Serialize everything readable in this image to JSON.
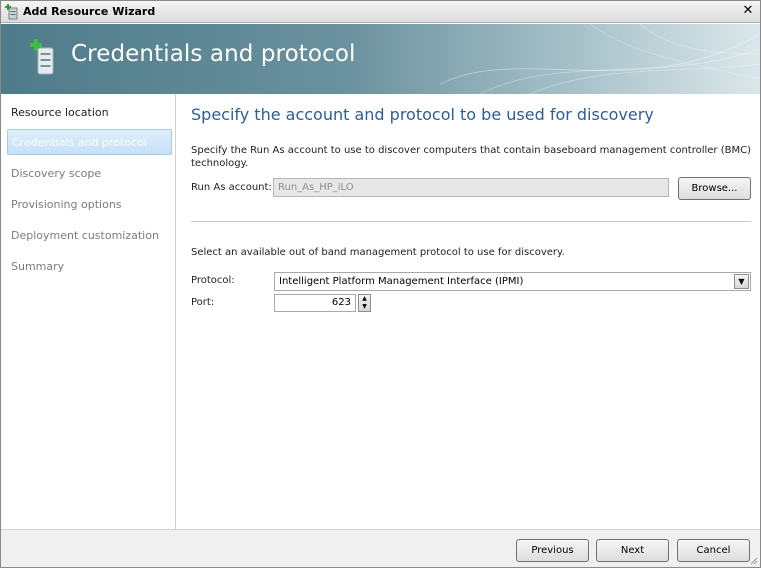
{
  "window": {
    "title": "Add Resource Wizard",
    "close_glyph": "✕"
  },
  "banner": {
    "title": "Credentials and protocol"
  },
  "nav": {
    "items": [
      {
        "label": "Resource location",
        "state": "visited"
      },
      {
        "label": "Credentials and protocol",
        "state": "selected"
      },
      {
        "label": "Discovery scope",
        "state": "upcoming"
      },
      {
        "label": "Provisioning options",
        "state": "upcoming"
      },
      {
        "label": "Deployment customization",
        "state": "upcoming"
      },
      {
        "label": "Summary",
        "state": "upcoming"
      }
    ]
  },
  "main": {
    "heading": "Specify the account and protocol to be used for discovery",
    "description": "Specify the Run As account to use to discover computers that contain baseboard management controller (BMC) technology.",
    "run_as_label": "Run As account:",
    "run_as_value": "Run_As_HP_iLO",
    "browse_label": "Browse...",
    "protocol_intro": "Select an available out of band management protocol to use for discovery.",
    "protocol_label": "Protocol:",
    "protocol_value": "Intelligent Platform Management Interface (IPMI)",
    "port_label": "Port:",
    "port_value": "623"
  },
  "footer": {
    "previous_label": "Previous",
    "next_label": "Next",
    "cancel_label": "Cancel"
  },
  "colors": {
    "heading": "#2b5e98",
    "banner_start": "#4e7b8a",
    "nav_selected": "#c6e0f7"
  },
  "icons": [
    "wizard-app-icon",
    "close-icon",
    "server-add-icon",
    "dropdown-arrow-icon",
    "spin-up-icon",
    "spin-down-icon",
    "resize-grip-icon"
  ]
}
